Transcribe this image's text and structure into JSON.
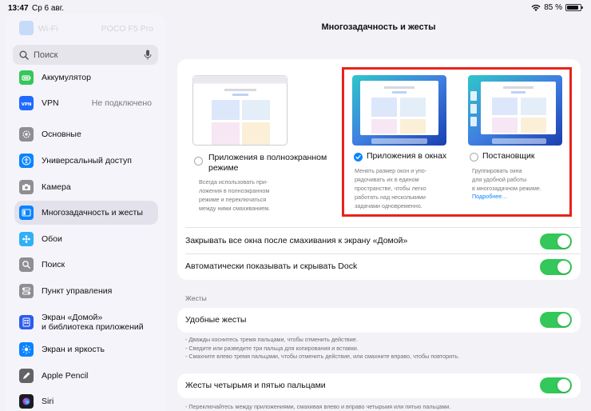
{
  "status": {
    "time": "13:47",
    "date": "Ср 6 авг.",
    "battery": "85 %",
    "battery_level": 0.85
  },
  "sidebar": {
    "faded_top": {
      "label": "Wi‑Fi",
      "value": "POCO F5 Pro"
    },
    "search_placeholder": "Поиск",
    "items": [
      {
        "label": "Аккумулятор",
        "icon": "battery-icon",
        "color": "#34c759"
      },
      {
        "label": "VPN",
        "value": "Не подключено",
        "icon": "vpn-icon",
        "color": "#1f6bff"
      },
      {
        "label": "Основные",
        "icon": "gear-icon",
        "color": "#8e8e93"
      },
      {
        "label": "Универсальный доступ",
        "icon": "accessibility-icon",
        "color": "#0a84ff"
      },
      {
        "label": "Камера",
        "icon": "camera-icon",
        "color": "#8e8e93"
      },
      {
        "label": "Многозадачность и жесты",
        "icon": "multitasking-icon",
        "color": "#0a84ff"
      },
      {
        "label": "Обои",
        "icon": "wallpaper-icon",
        "color": "#30b0f5"
      },
      {
        "label": "Поиск",
        "icon": "search-icon",
        "color": "#8e8e93"
      },
      {
        "label": "Пункт управления",
        "icon": "control-center-icon",
        "color": "#8e8e93"
      },
      {
        "label": "Экран «Домой»\nи библиотека приложений",
        "icon": "home-screen-icon",
        "color": "#2c5cf0"
      },
      {
        "label": "Экран и яркость",
        "icon": "brightness-icon",
        "color": "#0a84ff"
      },
      {
        "label": "Apple Pencil",
        "icon": "pencil-icon",
        "color": "#636366"
      },
      {
        "label": "Siri",
        "icon": "siri-icon",
        "color": "#1c1c1e"
      }
    ]
  },
  "page_title": "Многозадачность и жесты",
  "modes": [
    {
      "title": "Приложения в полноэкранном\nрежиме",
      "desc": "Всегда использовать при-\nложения в полноэкранном\nрежиме и переключаться\nмежду ними смахиванием.",
      "selected": false
    },
    {
      "title": "Приложения в окнах",
      "desc": "Менять размер окон и упо-\nрядочивать их в едином\nпространстве, чтобы легко\nработать над несколькими\nзадачами одновременно.",
      "selected": true
    },
    {
      "title": "Постановщик",
      "desc": "Группировать окна\nдля удобной работы\nв многозадачном режиме.",
      "link": "Подробнее…",
      "selected": false
    }
  ],
  "toggles": {
    "close_all": "Закрывать все окна после смахивания к экрану «Домой»",
    "auto_dock": "Автоматически показывать и скрывать Dock"
  },
  "gestures": {
    "section": "Жесты",
    "handy": "Удобные жесты",
    "handy_notes": [
      "- Дважды коснитесь тремя пальцами, чтобы отменить действие.",
      "- Сведите или разведите три пальца для копирования и вставки.",
      "- Смахните влево тремя пальцами, чтобы отменить действие, или смахните вправо, чтобы повторить."
    ],
    "four_five": "Жесты четырьмя и пятью пальцами",
    "four_five_note": "- Переключайтесь между приложениями, смахивая влево и вправо четырьмя или пятью пальцами."
  },
  "colors": {
    "accent": "#0a84ff",
    "toggle_on": "#34c759",
    "highlight": "#e8231b"
  }
}
